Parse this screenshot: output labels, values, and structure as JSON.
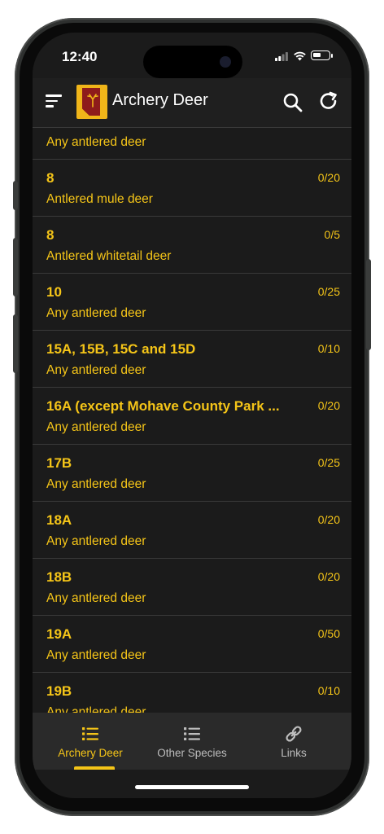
{
  "status": {
    "time": "12:40",
    "battery_level": 0.55
  },
  "appbar": {
    "title": "Archery Deer"
  },
  "list": {
    "partial_top_desc": "Any antlered deer",
    "rows": [
      {
        "hunt": "8",
        "count": "0/20",
        "desc": "Antlered mule deer"
      },
      {
        "hunt": "8",
        "count": "0/5",
        "desc": "Antlered whitetail deer"
      },
      {
        "hunt": "10",
        "count": "0/25",
        "desc": "Any antlered deer"
      },
      {
        "hunt": "15A, 15B, 15C and 15D",
        "count": "0/10",
        "desc": "Any antlered deer"
      },
      {
        "hunt": "16A (except Mohave County Park ...",
        "count": "0/20",
        "desc": "Any antlered deer"
      },
      {
        "hunt": "17B",
        "count": "0/25",
        "desc": "Any antlered deer"
      },
      {
        "hunt": "18A",
        "count": "0/20",
        "desc": "Any antlered deer"
      },
      {
        "hunt": "18B",
        "count": "0/20",
        "desc": "Any antlered deer"
      },
      {
        "hunt": "19A",
        "count": "0/50",
        "desc": "Any antlered deer"
      },
      {
        "hunt": "19B",
        "count": "0/10",
        "desc": "Any antlered deer"
      }
    ]
  },
  "tabs": [
    {
      "label": "Archery Deer",
      "icon": "list-icon",
      "active": true
    },
    {
      "label": "Other Species",
      "icon": "list-icon",
      "active": false
    },
    {
      "label": "Links",
      "icon": "link-icon",
      "active": false
    }
  ],
  "colors": {
    "accent": "#f5c518",
    "inactive": "#bdbdbd",
    "background": "#1b1b1b"
  }
}
